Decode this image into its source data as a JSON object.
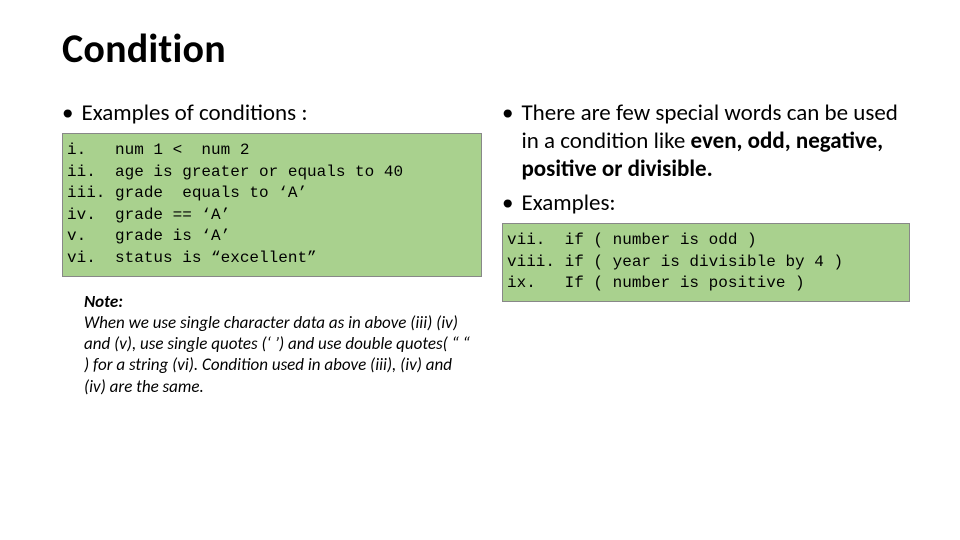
{
  "title": "Condition",
  "left": {
    "bullet": "Examples of conditions :",
    "code": "i.   num 1 <  num 2\nii.  age is greater or equals to 40\niii. grade  equals to ‘A’\niv.  grade == ‘A’\nv.   grade is ‘A’\nvi.  status is “excellent”",
    "note_label": "Note:",
    "note_body": "When we use single character data as in above (iii) (iv) and (v), use single quotes (‘ ’) and use double quotes( “  “ ) for a string (vi). Condition used in  above (iii), (iv) and (iv) are the same."
  },
  "right": {
    "bullet1_pre": "There are  few special words can be used  in a condition like ",
    "bullet1_bold": "even, odd, negative, positive or divisible.",
    "bullet2": "Examples:",
    "code": "vii.  if ( number is odd )\nviii. if ( year is divisible by 4 )\nix.   If ( number is positive )"
  }
}
